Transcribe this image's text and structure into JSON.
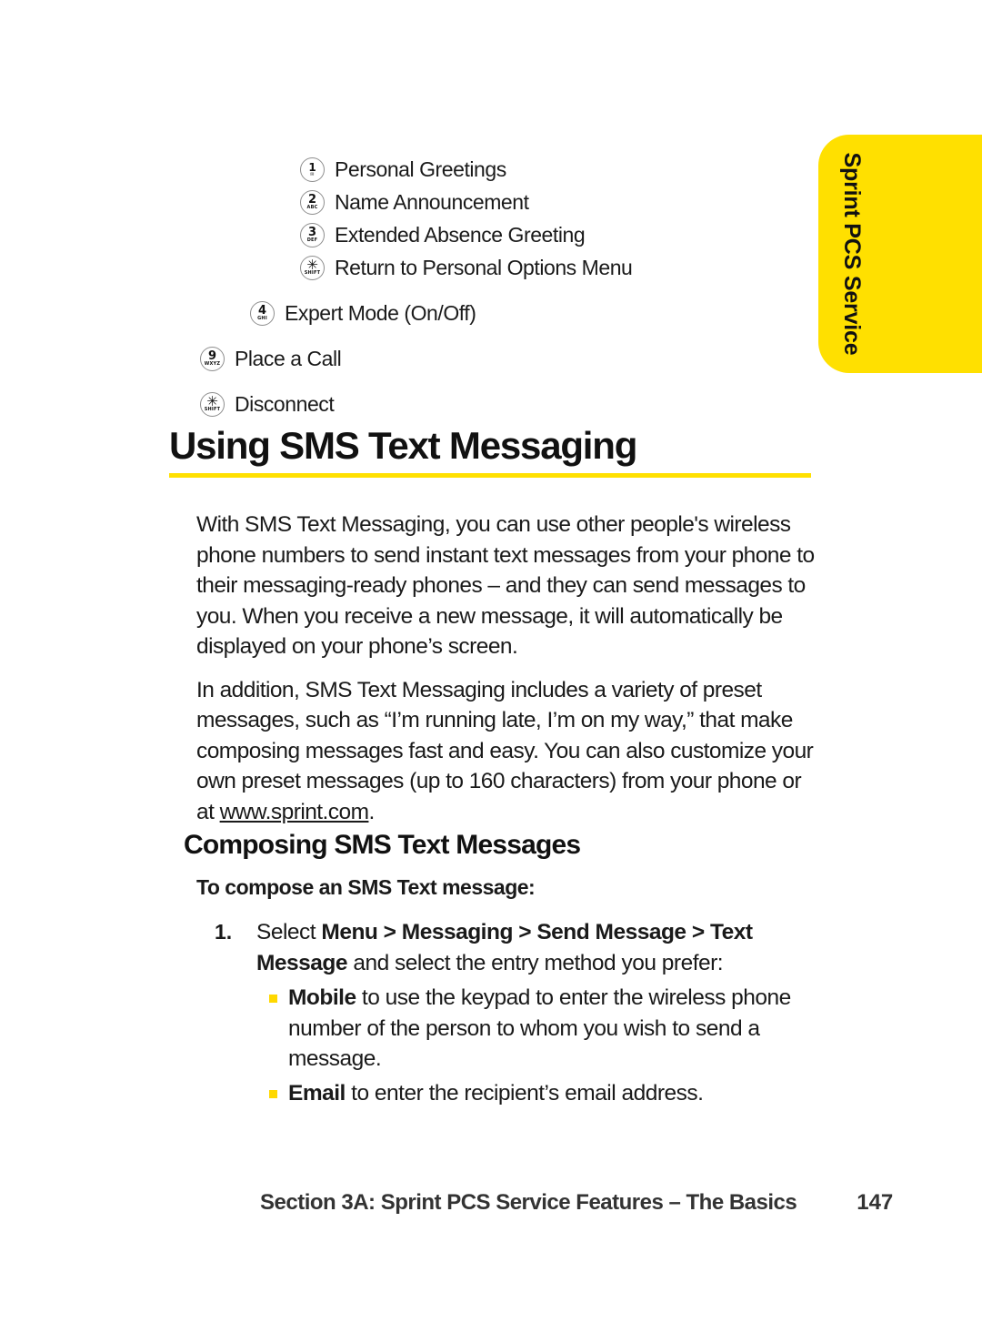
{
  "side_tab": {
    "label": "Sprint PCS Service",
    "color": "#FFE000"
  },
  "keypad_menu": {
    "items": [
      {
        "key": "1",
        "sub": "✉",
        "label": "Personal Greetings",
        "indent": "lvl2"
      },
      {
        "key": "2",
        "sub": "ABC",
        "label": "Name Announcement",
        "indent": "lvl2"
      },
      {
        "key": "3",
        "sub": "DEF",
        "label": "Extended Absence Greeting",
        "indent": "lvl2"
      },
      {
        "key": "✳",
        "sub": "SHIFT",
        "label": "Return to Personal Options Menu",
        "indent": "lvl2"
      },
      {
        "key": "4",
        "sub": "GHI",
        "label": "Expert Mode (On/Off)",
        "indent": "lvl1"
      },
      {
        "key": "9",
        "sub": "WXYZ",
        "label": "Place a Call",
        "indent": "lvl0"
      },
      {
        "key": "✳",
        "sub": "SHIFT",
        "label": "Disconnect",
        "indent": "lvl0"
      }
    ]
  },
  "heading": {
    "title": "Using SMS Text Messaging",
    "rule_color": "#FFE000"
  },
  "paragraphs": {
    "p1_a": "With SMS Text Messaging, you can use other people's wireless phone numbers to send instant text messages from your phone to their messaging-ready phones – and they can send messages to you. When you receive a new message, it will automatically be displayed on your phone’s screen.",
    "p2_a": "In addition, SMS Text Messaging includes a variety of preset messages, such as “I’m running late, I’m on my way,” that make composing messages fast and easy. You can also customize your own preset messages (up to 160 characters) from your phone or at ",
    "p2_link": "www.sprint.com",
    "p2_b": "."
  },
  "subsection": {
    "heading": "Composing SMS Text Messages",
    "lead_in": "To compose an SMS Text message:"
  },
  "steps": [
    {
      "number": "1.",
      "text_a": "Select ",
      "text_bold": "Menu > Messaging > Send Message > Text Message",
      "text_b": " and select the entry method you prefer:"
    }
  ],
  "bullets": [
    {
      "bold": "Mobile",
      "text": " to use the keypad to enter the wireless phone number of the person to whom you wish to send a message."
    },
    {
      "bold": "Email",
      "text": " to enter the recipient’s email address."
    }
  ],
  "footer": {
    "section": "Section 3A: Sprint PCS Service Features – The Basics",
    "page": "147"
  },
  "colors": {
    "yellow": "#FFE000",
    "bullet_yellow": "#FFD800",
    "text": "#1a1a1a"
  }
}
